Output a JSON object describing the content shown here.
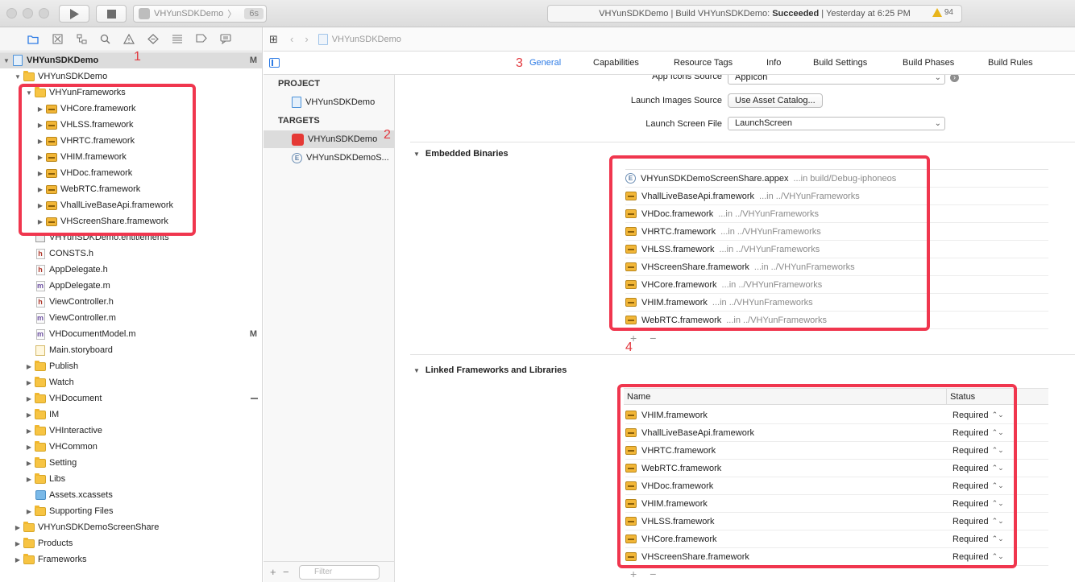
{
  "titlebar": {
    "scheme_name": "VHYunSDKDemo",
    "scheme_device": "6s",
    "status_prefix": "VHYunSDKDemo | Build VHYunSDKDemo:",
    "status_result": "Succeeded",
    "status_time": "| Yesterday at 6:25 PM",
    "warning_count": "94"
  },
  "navigator": {
    "items": [
      {
        "label": "VHYunSDKDemo",
        "badge": "M"
      },
      {
        "label": "VHYunSDKDemo"
      },
      {
        "label": "VHYunFrameworks"
      },
      {
        "label": "VHCore.framework"
      },
      {
        "label": "VHLSS.framework"
      },
      {
        "label": "VHRTC.framework"
      },
      {
        "label": "VHIM.framework"
      },
      {
        "label": "VHDoc.framework"
      },
      {
        "label": "WebRTC.framework"
      },
      {
        "label": "VhallLiveBaseApi.framework"
      },
      {
        "label": "VHScreenShare.framework"
      },
      {
        "label": "VHYunSDKDemo.entitlements"
      },
      {
        "label": "CONSTS.h"
      },
      {
        "label": "AppDelegate.h"
      },
      {
        "label": "AppDelegate.m"
      },
      {
        "label": "ViewController.h"
      },
      {
        "label": "ViewController.m"
      },
      {
        "label": "VHDocumentModel.m",
        "badge": "M"
      },
      {
        "label": "Main.storyboard"
      },
      {
        "label": "Publish"
      },
      {
        "label": "Watch"
      },
      {
        "label": "VHDocument"
      },
      {
        "label": "IM"
      },
      {
        "label": "VHInteractive"
      },
      {
        "label": "VHCommon"
      },
      {
        "label": "Setting"
      },
      {
        "label": "Libs"
      },
      {
        "label": "Assets.xcassets"
      },
      {
        "label": "Supporting Files"
      },
      {
        "label": "VHYunSDKDemoScreenShare"
      },
      {
        "label": "Products"
      },
      {
        "label": "Frameworks"
      }
    ]
  },
  "editor": {
    "breadcrumb": "VHYunSDKDemo",
    "tabs": [
      "General",
      "Capabilities",
      "Resource Tags",
      "Info",
      "Build Settings",
      "Build Phases",
      "Build Rules"
    ]
  },
  "targets": {
    "project_header": "PROJECT",
    "project_item": "VHYunSDKDemo",
    "targets_header": "TARGETS",
    "target_items": [
      "VHYunSDKDemo",
      "VHYunSDKDemoS..."
    ],
    "filter_placeholder": "Filter"
  },
  "settings": {
    "app_icons_label": "App Icons Source",
    "app_icons_value": "AppIcon",
    "launch_images_label": "Launch Images Source",
    "launch_images_button": "Use Asset Catalog...",
    "launch_screen_label": "Launch Screen File",
    "launch_screen_value": "LaunchScreen",
    "embedded_header": "Embedded Binaries",
    "embedded": [
      {
        "name": "VHYunSDKDemoScreenShare.appex",
        "loc": "...in build/Debug-iphoneos"
      },
      {
        "name": "VhallLiveBaseApi.framework",
        "loc": "...in ../VHYunFrameworks"
      },
      {
        "name": "VHDoc.framework",
        "loc": "...in ../VHYunFrameworks"
      },
      {
        "name": "VHRTC.framework",
        "loc": "...in ../VHYunFrameworks"
      },
      {
        "name": "VHLSS.framework",
        "loc": "...in ../VHYunFrameworks"
      },
      {
        "name": "VHScreenShare.framework",
        "loc": "...in ../VHYunFrameworks"
      },
      {
        "name": "VHCore.framework",
        "loc": "...in ../VHYunFrameworks"
      },
      {
        "name": "VHIM.framework",
        "loc": "...in ../VHYunFrameworks"
      },
      {
        "name": "WebRTC.framework",
        "loc": "...in ../VHYunFrameworks"
      }
    ],
    "linked_header": "Linked Frameworks and Libraries",
    "linked_col_name": "Name",
    "linked_col_status": "Status",
    "linked": [
      {
        "name": "VHIM.framework",
        "status": "Required"
      },
      {
        "name": "VhallLiveBaseApi.framework",
        "status": "Required"
      },
      {
        "name": "VHRTC.framework",
        "status": "Required"
      },
      {
        "name": "WebRTC.framework",
        "status": "Required"
      },
      {
        "name": "VHDoc.framework",
        "status": "Required"
      },
      {
        "name": "VHIM.framework",
        "status": "Required"
      },
      {
        "name": "VHLSS.framework",
        "status": "Required"
      },
      {
        "name": "VHCore.framework",
        "status": "Required"
      },
      {
        "name": "VHScreenShare.framework",
        "status": "Required"
      }
    ]
  },
  "annotations": {
    "n1": "1",
    "n2": "2",
    "n3": "3",
    "n4": "4",
    "accent": "#f0364e"
  }
}
